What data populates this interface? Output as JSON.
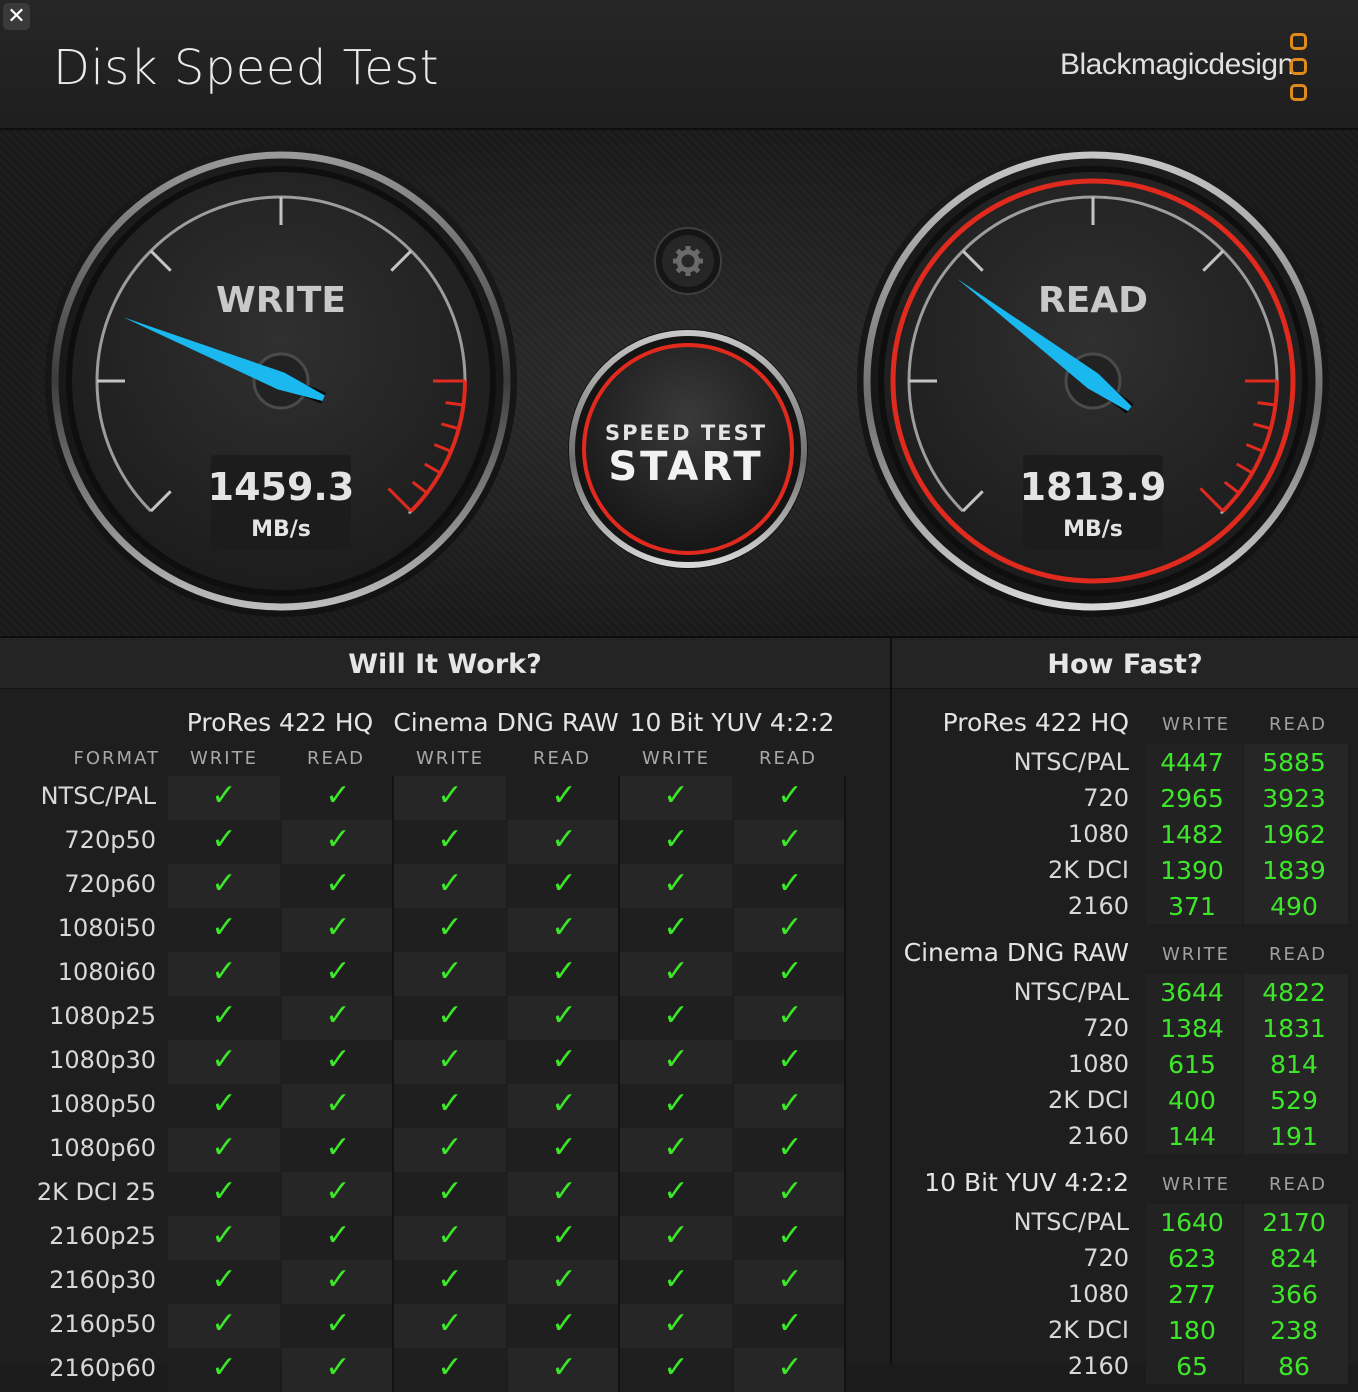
{
  "window": {
    "close_label": "✕",
    "title": "Disk Speed Test",
    "brand": "Blackmagicdesign"
  },
  "colors": {
    "check": "#3ee62a",
    "needle": "#1ab8ee",
    "accent_red": "#e02a1e",
    "brand_orange": "#e08a1c"
  },
  "gauges": {
    "write": {
      "label": "WRITE",
      "value": "1459.3",
      "unit": "MB/s"
    },
    "read": {
      "label": "READ",
      "value": "1813.9",
      "unit": "MB/s"
    },
    "settings_icon": "gear-icon",
    "start_button": {
      "top_label": "SPEED TEST",
      "main_label": "START"
    }
  },
  "will_it_work": {
    "title": "Will It Work?",
    "format_label": "FORMAT",
    "groups": [
      {
        "name": "ProRes 422 HQ",
        "write": "WRITE",
        "read": "READ"
      },
      {
        "name": "Cinema DNG RAW",
        "write": "WRITE",
        "read": "READ"
      },
      {
        "name": "10 Bit YUV 4:2:2",
        "write": "WRITE",
        "read": "READ"
      }
    ],
    "check_glyph": "✓",
    "rows": [
      "NTSC/PAL",
      "720p50",
      "720p60",
      "1080i50",
      "1080i60",
      "1080p25",
      "1080p30",
      "1080p50",
      "1080p60",
      "2K DCI 25",
      "2160p25",
      "2160p30",
      "2160p50",
      "2160p60"
    ]
  },
  "how_fast": {
    "title": "How Fast?",
    "write_label": "WRITE",
    "read_label": "READ",
    "groups": [
      {
        "name": "ProRes 422 HQ",
        "rows": [
          {
            "label": "NTSC/PAL",
            "write": "4447",
            "read": "5885"
          },
          {
            "label": "720",
            "write": "2965",
            "read": "3923"
          },
          {
            "label": "1080",
            "write": "1482",
            "read": "1962"
          },
          {
            "label": "2K DCI",
            "write": "1390",
            "read": "1839"
          },
          {
            "label": "2160",
            "write": "371",
            "read": "490"
          }
        ]
      },
      {
        "name": "Cinema DNG RAW",
        "rows": [
          {
            "label": "NTSC/PAL",
            "write": "3644",
            "read": "4822"
          },
          {
            "label": "720",
            "write": "1384",
            "read": "1831"
          },
          {
            "label": "1080",
            "write": "615",
            "read": "814"
          },
          {
            "label": "2K DCI",
            "write": "400",
            "read": "529"
          },
          {
            "label": "2160",
            "write": "144",
            "read": "191"
          }
        ]
      },
      {
        "name": "10 Bit YUV 4:2:2",
        "rows": [
          {
            "label": "NTSC/PAL",
            "write": "1640",
            "read": "2170"
          },
          {
            "label": "720",
            "write": "623",
            "read": "824"
          },
          {
            "label": "1080",
            "write": "277",
            "read": "366"
          },
          {
            "label": "2K DCI",
            "write": "180",
            "read": "238"
          },
          {
            "label": "2160",
            "write": "65",
            "read": "86"
          }
        ]
      }
    ]
  }
}
